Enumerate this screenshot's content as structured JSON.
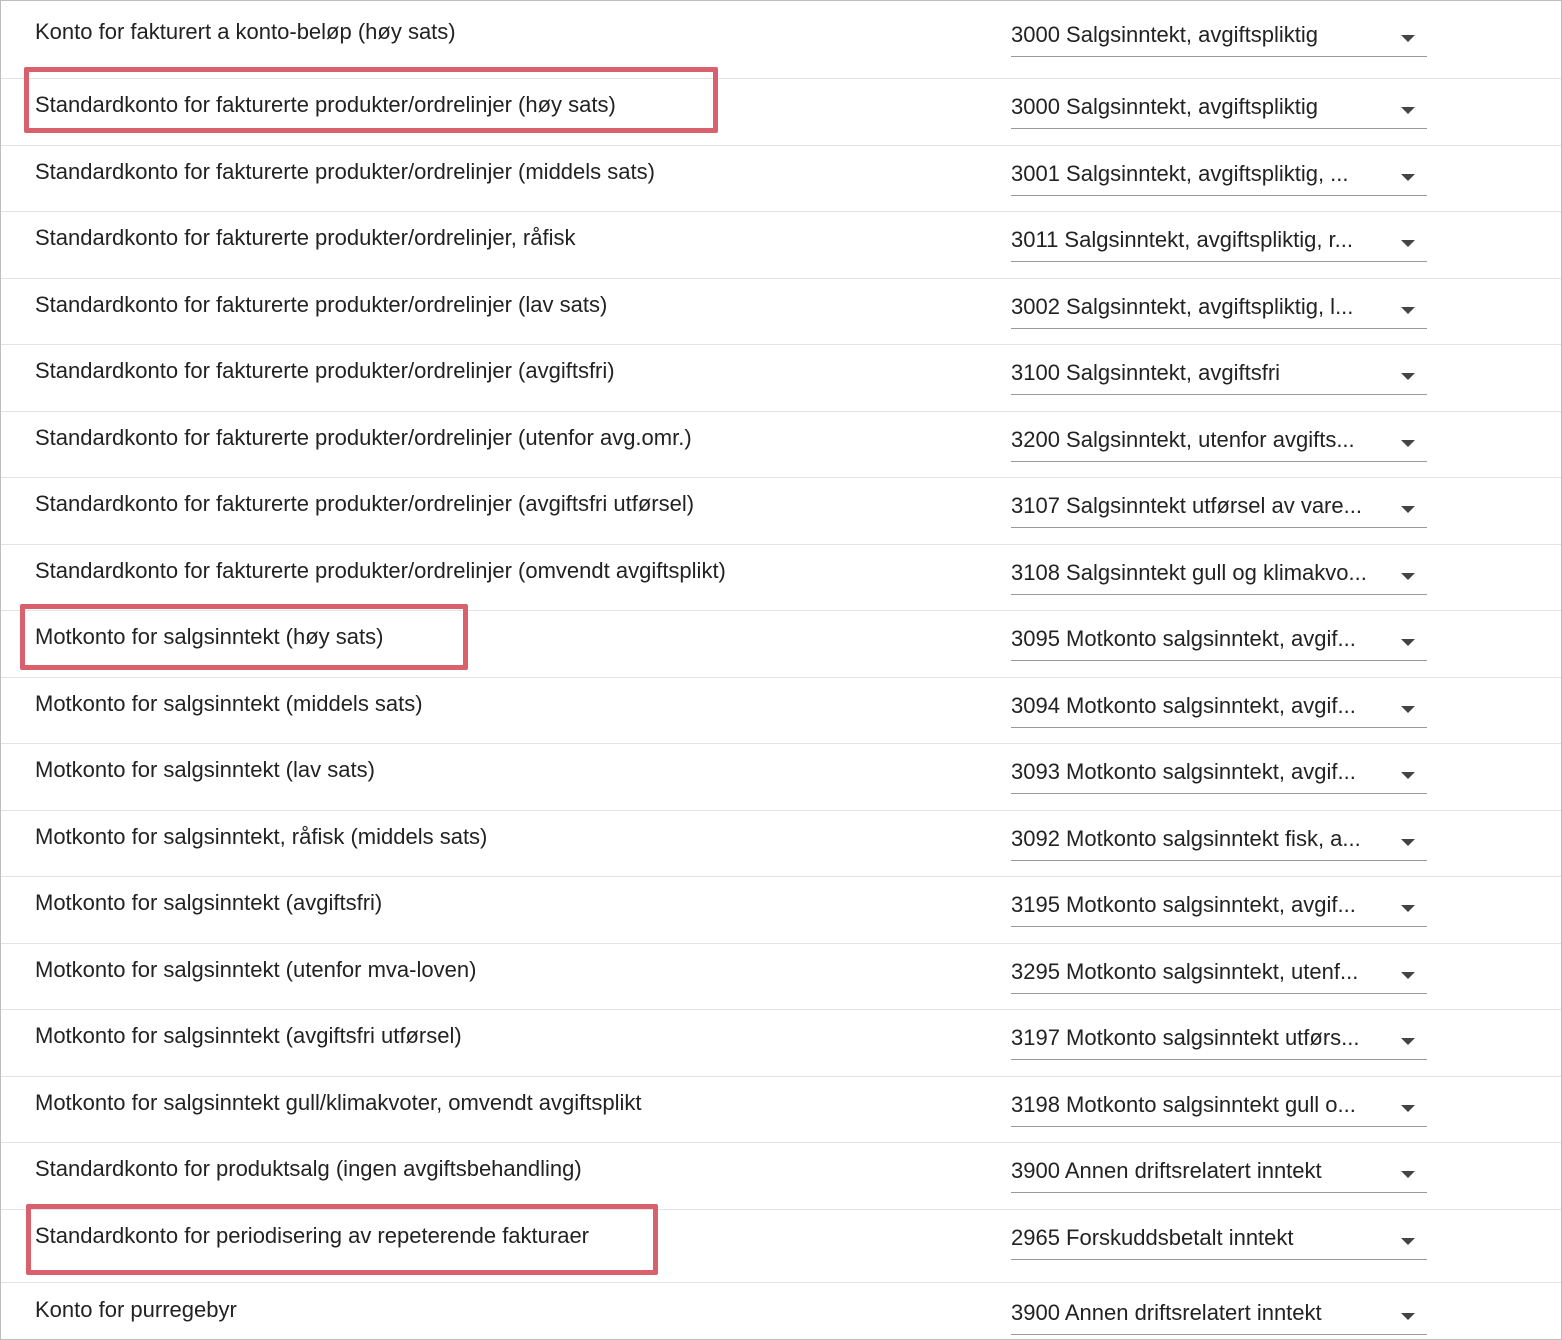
{
  "accent_colors": {
    "highlight": "#d9616d",
    "divider": "#e3e3e3",
    "underline": "#9a9a9a"
  },
  "rows": [
    {
      "label": "Konto for fakturert a konto-beløp (høy sats)",
      "value": "3000 Salgsinntekt, avgiftspliktig"
    },
    {
      "label": "Standardkonto for fakturerte produkter/ordrelinjer (høy sats)",
      "value": "3000 Salgsinntekt, avgiftspliktig"
    },
    {
      "label": "Standardkonto for fakturerte produkter/ordrelinjer (middels sats)",
      "value": "3001 Salgsinntekt, avgiftspliktig, ..."
    },
    {
      "label": "Standardkonto for fakturerte produkter/ordrelinjer, råfisk",
      "value": "3011 Salgsinntekt, avgiftspliktig, r..."
    },
    {
      "label": "Standardkonto for fakturerte produkter/ordrelinjer (lav sats)",
      "value": "3002 Salgsinntekt, avgiftspliktig, l..."
    },
    {
      "label": "Standardkonto for fakturerte produkter/ordrelinjer (avgiftsfri)",
      "value": "3100 Salgsinntekt, avgiftsfri"
    },
    {
      "label": "Standardkonto for fakturerte produkter/ordrelinjer (utenfor avg.omr.)",
      "value": "3200 Salgsinntekt, utenfor avgifts..."
    },
    {
      "label": "Standardkonto for fakturerte produkter/ordrelinjer (avgiftsfri utførsel)",
      "value": "3107 Salgsinntekt utførsel av vare..."
    },
    {
      "label": "Standardkonto for fakturerte produkter/ordrelinjer (omvendt avgiftsplikt)",
      "value": "3108 Salgsinntekt gull og klimakvo..."
    },
    {
      "label": "Motkonto for salgsinntekt (høy sats)",
      "value": "3095 Motkonto salgsinntekt, avgif..."
    },
    {
      "label": "Motkonto for salgsinntekt (middels sats)",
      "value": "3094 Motkonto salgsinntekt, avgif..."
    },
    {
      "label": "Motkonto for salgsinntekt (lav sats)",
      "value": "3093 Motkonto salgsinntekt, avgif..."
    },
    {
      "label": "Motkonto for salgsinntekt, råfisk (middels sats)",
      "value": "3092 Motkonto salgsinntekt fisk, a..."
    },
    {
      "label": "Motkonto for salgsinntekt (avgiftsfri)",
      "value": "3195 Motkonto salgsinntekt, avgif..."
    },
    {
      "label": "Motkonto for salgsinntekt (utenfor mva-loven)",
      "value": "3295 Motkonto salgsinntekt, utenf..."
    },
    {
      "label": "Motkonto for salgsinntekt (avgiftsfri utførsel)",
      "value": "3197 Motkonto salgsinntekt utførs..."
    },
    {
      "label": "Motkonto for salgsinntekt gull/klimakvoter, omvendt avgiftsplikt",
      "value": "3198 Motkonto salgsinntekt gull o..."
    },
    {
      "label": "Standardkonto for produktsalg (ingen avgiftsbehandling)",
      "value": "3900 Annen driftsrelatert inntekt"
    },
    {
      "label": "Standardkonto for periodisering av repeterende fakturaer",
      "value": "2965 Forskuddsbetalt inntekt"
    },
    {
      "label": "Konto for purregebyr",
      "value": "3900 Annen driftsrelatert inntekt"
    }
  ]
}
